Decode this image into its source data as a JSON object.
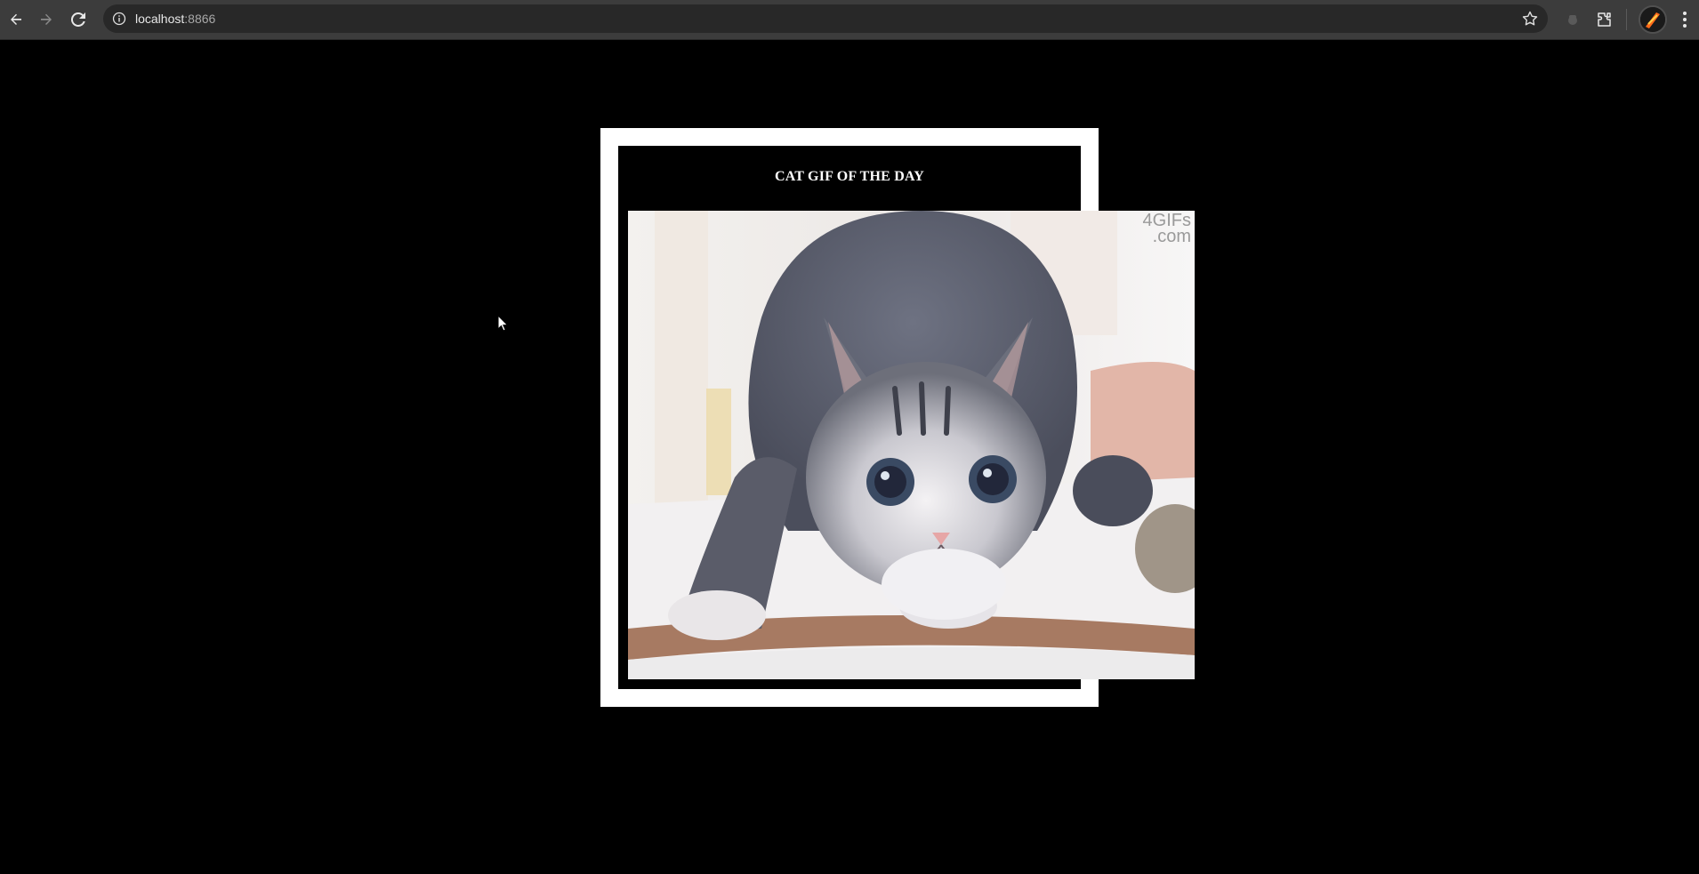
{
  "browser": {
    "url_host": "localhost",
    "url_port": ":8866",
    "icons": {
      "back": "back-arrow-icon",
      "forward": "forward-arrow-icon",
      "reload": "reload-icon",
      "site_info": "info-icon",
      "bookmark": "star-icon",
      "extension_ghost": "puzzle-icon",
      "extensions": "extensions-icon",
      "profile": "avatar",
      "menu": "kebab-menu-icon"
    }
  },
  "page": {
    "title": "CAT GIF OF THE DAY",
    "gif": {
      "watermark_line1": "4GIFs",
      "watermark_line2": ".com"
    }
  },
  "colors": {
    "background": "#000000",
    "frame": "#ffffff",
    "chrome": "#3c3c3c",
    "omnibox": "#282828"
  }
}
